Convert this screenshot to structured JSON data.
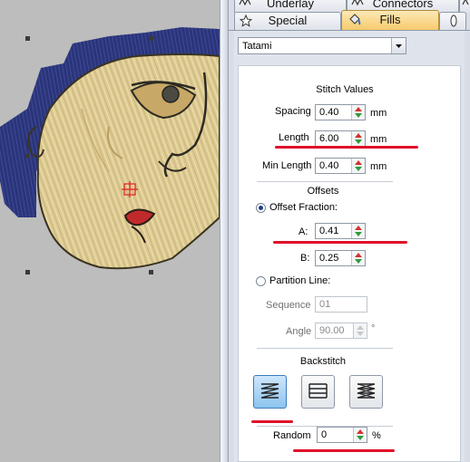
{
  "tabs": [
    {
      "label": "Underlay"
    },
    {
      "label": "Connectors"
    },
    {
      "label": "Special"
    },
    {
      "label": "Fills"
    }
  ],
  "fill_type": "Tatami",
  "stitch_values": {
    "heading": "Stitch Values",
    "spacing": {
      "label": "Spacing",
      "value": "0.40",
      "unit": "mm"
    },
    "length": {
      "label": "Length",
      "value": "6.00",
      "unit": "mm"
    },
    "min_length": {
      "label": "Min Length",
      "value": "0.40",
      "unit": "mm"
    }
  },
  "offsets": {
    "heading": "Offsets",
    "offset_fraction": {
      "label": "Offset Fraction:",
      "selected": true
    },
    "a": {
      "label": "A:",
      "value": "0.41"
    },
    "b": {
      "label": "B:",
      "value": "0.25"
    },
    "partition_line": {
      "label": "Partition Line:",
      "selected": false
    },
    "sequence": {
      "label": "Sequence",
      "value": "01"
    },
    "angle": {
      "label": "Angle",
      "value": "90.00",
      "unit": "°"
    }
  },
  "backstitch": {
    "heading": "Backstitch",
    "options": [
      "backstitch-zigzag",
      "backstitch-parallel",
      "backstitch-zigzag-alt"
    ],
    "selected_index": 0
  },
  "random": {
    "label": "Random",
    "value": "0",
    "unit": "%"
  },
  "colors": {
    "highlight": "#e0102a",
    "selected_tab": "#f6c96a",
    "thread_tan": "#d9c78e",
    "thread_blue": "#25306f"
  }
}
